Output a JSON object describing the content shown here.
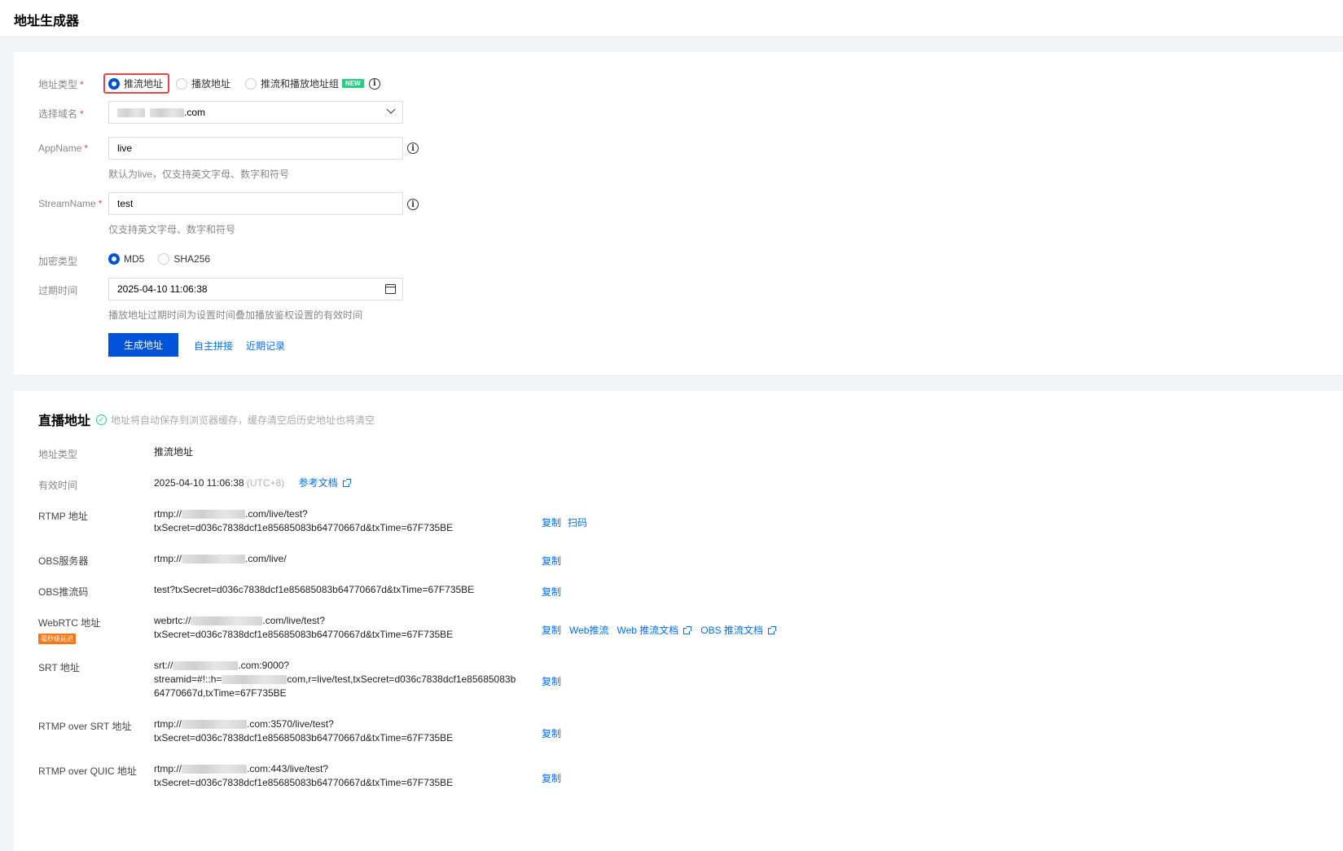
{
  "header": {
    "title": "地址生成器"
  },
  "form": {
    "address_type": {
      "label": "地址类型",
      "required_mark": "*",
      "options": [
        {
          "label": "推流地址",
          "selected": true
        },
        {
          "label": "播放地址",
          "selected": false
        },
        {
          "label": "推流和播放地址组",
          "selected": false,
          "badge": "NEW"
        }
      ]
    },
    "domain": {
      "label": "选择域名",
      "required_mark": "*",
      "value_suffix": ".com"
    },
    "appname": {
      "label": "AppName",
      "required_mark": "*",
      "value": "live",
      "hint": "默认为live，仅支持英文字母、数字和符号"
    },
    "streamname": {
      "label": "StreamName",
      "required_mark": "*",
      "value": "test",
      "hint": "仅支持英文字母、数字和符号"
    },
    "encryption": {
      "label": "加密类型",
      "options": [
        {
          "label": "MD5",
          "selected": true
        },
        {
          "label": "SHA256",
          "selected": false
        }
      ]
    },
    "expiry": {
      "label": "过期时间",
      "value": "2025-04-10 11:06:38",
      "hint": "播放地址过期时间为设置时间叠加播放鉴权设置的有效时间"
    },
    "actions": {
      "generate": "生成地址",
      "custom": "自主拼接",
      "recent": "近期记录"
    }
  },
  "results": {
    "title": "直播地址",
    "notice": "地址将自动保存到浏览器缓存，缓存清空后历史地址也将清空",
    "address_type": {
      "label": "地址类型",
      "value": "推流地址"
    },
    "valid_time": {
      "label": "有效时间",
      "value": "2025-04-10 11:06:38",
      "tz": "(UTC+8)",
      "doc_link": "参考文档"
    },
    "rows": {
      "rtmp": {
        "label": "RTMP 地址",
        "line1_prefix": "rtmp://",
        "line1_suffix": ".com/live/test?",
        "line2": "txSecret=d036c7838dcf1e85685083b64770667d&txTime=67F735BE",
        "copy": "复制",
        "scan": "扫码"
      },
      "obs_server": {
        "label": "OBS服务器",
        "prefix": "rtmp://",
        "suffix": ".com/live/",
        "copy": "复制"
      },
      "obs_key": {
        "label": "OBS推流码",
        "value": "test?txSecret=d036c7838dcf1e85685083b64770667d&txTime=67F735BE",
        "copy": "复制"
      },
      "webrtc": {
        "label": "WebRTC 地址",
        "badge": "毫秒级延迟",
        "line1_prefix": "webrtc://",
        "line1_suffix": ".com/live/test?",
        "line2": "txSecret=d036c7838dcf1e85685083b64770667d&txTime=67F735BE",
        "copy": "复制",
        "web_push": "Web推流",
        "web_doc": "Web 推流文档",
        "obs_doc": "OBS 推流文档"
      },
      "srt": {
        "label": "SRT 地址",
        "line1_prefix": "srt://",
        "line1_suffix": ".com:9000?",
        "line2_prefix": "streamid=#!::h=",
        "line2_suffix": "com,r=live/test,txSecret=d036c7838dcf1e85685083b",
        "line3": "64770667d,txTime=67F735BE",
        "copy": "复制"
      },
      "rtmp_srt": {
        "label": "RTMP over SRT 地址",
        "line1_prefix": "rtmp://",
        "line1_suffix": ".com:3570/live/test?",
        "line2": "txSecret=d036c7838dcf1e85685083b64770667d&txTime=67F735BE",
        "copy": "复制"
      },
      "rtmp_quic": {
        "label": "RTMP over QUIC 地址",
        "line1_prefix": "rtmp://",
        "line1_suffix": ".com:443/live/test?",
        "line2": "txSecret=d036c7838dcf1e85685083b64770667d&txTime=67F735BE",
        "copy": "复制"
      }
    }
  }
}
